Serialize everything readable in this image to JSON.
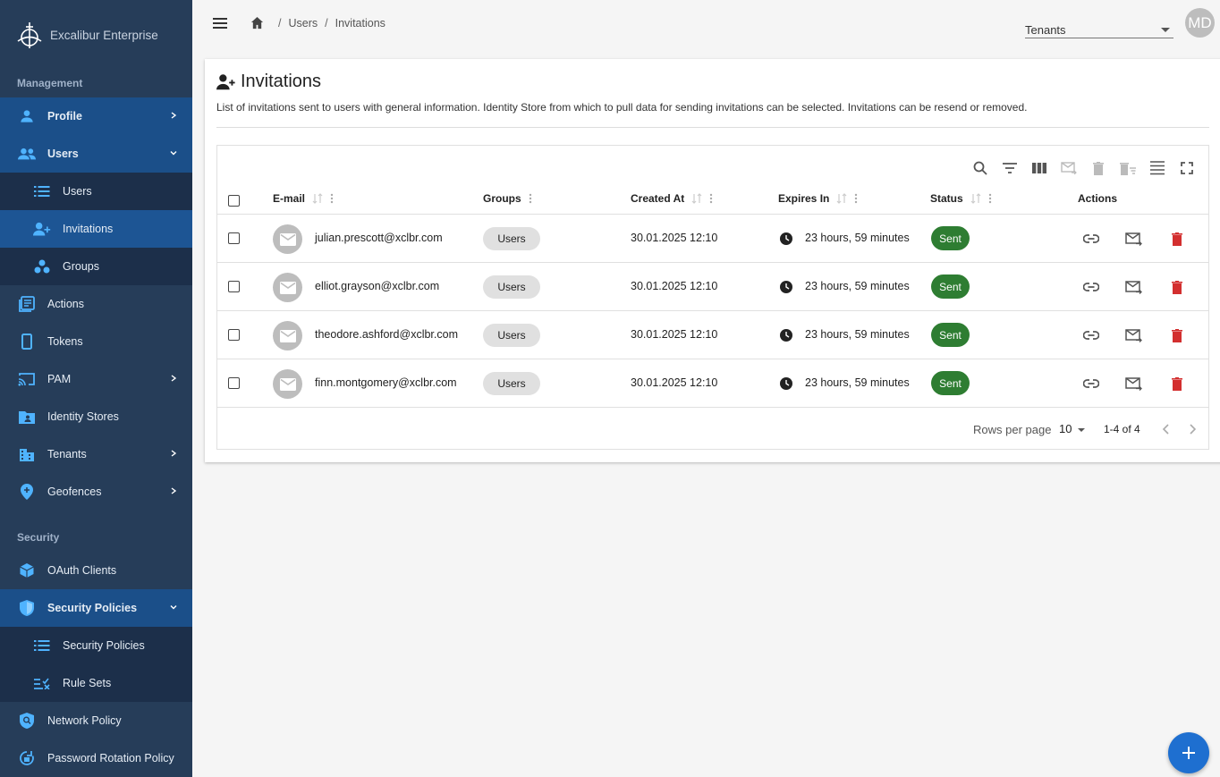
{
  "app": {
    "name": "Excalibur Enterprise"
  },
  "sidebar": {
    "sections": {
      "management": "Management",
      "security": "Security"
    },
    "items": {
      "profile": "Profile",
      "users": "Users",
      "users_sub_users": "Users",
      "users_sub_invitations": "Invitations",
      "users_sub_groups": "Groups",
      "actions": "Actions",
      "tokens": "Tokens",
      "pam": "PAM",
      "identity_stores": "Identity Stores",
      "tenants": "Tenants",
      "geofences": "Geofences",
      "oauth_clients": "OAuth Clients",
      "security_policies": "Security Policies",
      "security_policies_sub": "Security Policies",
      "rule_sets": "Rule Sets",
      "network_policy": "Network Policy",
      "password_rotation_policy": "Password Rotation Policy"
    }
  },
  "header": {
    "breadcrumb": [
      "Users",
      "Invitations"
    ],
    "tenants_select": "Tenants",
    "avatar_initials": "MD"
  },
  "page": {
    "title": "Invitations",
    "description": "List of invitations sent to users with general information. Identity Store from which to pull data for sending invitations can be selected. Invitations can be resend or removed."
  },
  "table": {
    "columns": {
      "email": "E-mail",
      "groups": "Groups",
      "created_at": "Created At",
      "expires_in": "Expires In",
      "status": "Status",
      "actions": "Actions"
    },
    "rows": [
      {
        "email": "julian.prescott@xclbr.com",
        "group": "Users",
        "created": "30.01.2025 12:10",
        "expires": "23 hours, 59 minutes",
        "status": "Sent"
      },
      {
        "email": "elliot.grayson@xclbr.com",
        "group": "Users",
        "created": "30.01.2025 12:10",
        "expires": "23 hours, 59 minutes",
        "status": "Sent"
      },
      {
        "email": "theodore.ashford@xclbr.com",
        "group": "Users",
        "created": "30.01.2025 12:10",
        "expires": "23 hours, 59 minutes",
        "status": "Sent"
      },
      {
        "email": "finn.montgomery@xclbr.com",
        "group": "Users",
        "created": "30.01.2025 12:10",
        "expires": "23 hours, 59 minutes",
        "status": "Sent"
      }
    ],
    "footer": {
      "rows_per_page_label": "Rows per page",
      "rows_per_page_value": "10",
      "range": "1-4 of 4"
    }
  },
  "colors": {
    "sidebar_bg": "#263d59",
    "sidebar_active": "#1d5594",
    "status_sent": "#2e7d32",
    "delete": "#d32f2f",
    "fab": "#1e6fd0"
  }
}
